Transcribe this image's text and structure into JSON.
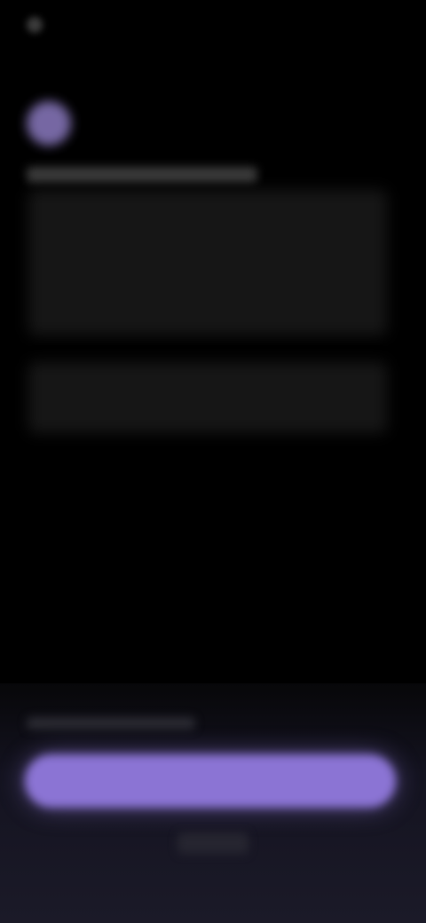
{
  "colors": {
    "background": "#000000",
    "accent": "#8b74d4",
    "avatar": "#8b7ac0",
    "sheet": "#1b1a28",
    "placeholder": "#161616"
  },
  "icons": {
    "back": "back-icon",
    "avatar": "avatar-icon"
  },
  "header": {
    "back_label": ""
  },
  "content": {
    "title": "",
    "body_1": "",
    "body_2": ""
  },
  "bottom_sheet": {
    "caption": "",
    "primary_label": "",
    "secondary_label": ""
  }
}
